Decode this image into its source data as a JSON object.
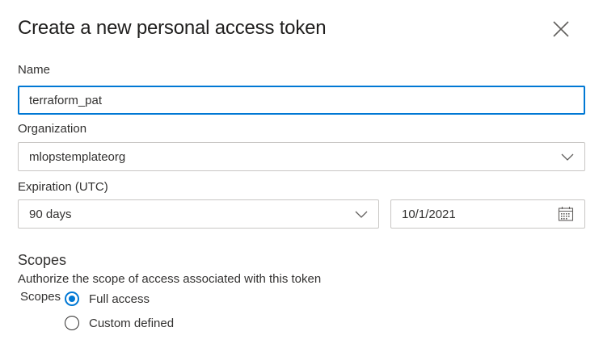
{
  "dialog": {
    "title": "Create a new personal access token"
  },
  "name_field": {
    "label": "Name",
    "value": "terraform_pat"
  },
  "organization_field": {
    "label": "Organization",
    "value": "mlopstemplateorg"
  },
  "expiration": {
    "label": "Expiration (UTC)",
    "duration_value": "90 days",
    "date_value": "10/1/2021"
  },
  "scopes": {
    "title": "Scopes",
    "description": "Authorize the scope of access associated with this token",
    "group_label": "Scopes",
    "options": [
      {
        "label": "Full access",
        "checked": true
      },
      {
        "label": "Custom defined",
        "checked": false
      }
    ]
  },
  "colors": {
    "accent": "#0078d4",
    "text": "#323130",
    "border": "#c8c6c4"
  }
}
